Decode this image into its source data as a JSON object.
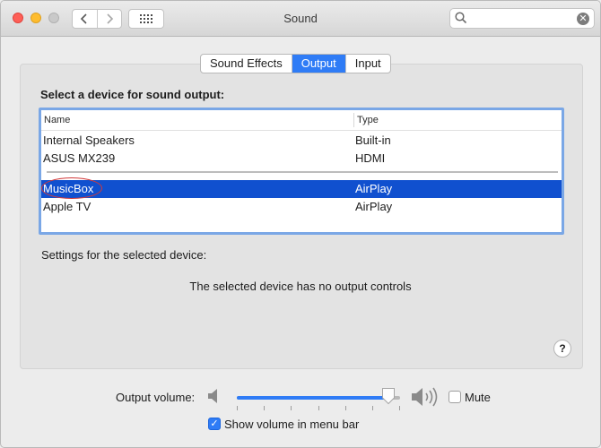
{
  "window": {
    "title": "Sound"
  },
  "search": {
    "placeholder": "",
    "value": ""
  },
  "tabs": [
    {
      "label": "Sound Effects",
      "active": false
    },
    {
      "label": "Output",
      "active": true
    },
    {
      "label": "Input",
      "active": false
    }
  ],
  "output": {
    "heading": "Select a device for sound output:",
    "columns": {
      "name": "Name",
      "type": "Type"
    },
    "devices": [
      {
        "name": "Internal Speakers",
        "type": "Built-in",
        "selected": false
      },
      {
        "name": "ASUS MX239",
        "type": "HDMI",
        "selected": false
      },
      {
        "name": "MusicBox",
        "type": "AirPlay",
        "selected": true
      },
      {
        "name": "Apple TV",
        "type": "AirPlay",
        "selected": false
      }
    ],
    "settings_label": "Settings for the selected device:",
    "no_controls_text": "The selected device has no output controls",
    "help_label": "?"
  },
  "volume": {
    "label": "Output volume:",
    "level": 0.93,
    "mute_label": "Mute",
    "mute_checked": false,
    "show_in_menu_bar_label": "Show volume in menu bar",
    "show_in_menu_bar_checked": true
  },
  "icons": {
    "back": "chevron-left-icon",
    "forward": "chevron-right-icon",
    "show_all": "grid-icon",
    "search": "search-icon",
    "clear": "clear-search-icon",
    "volume_low": "speaker-low-icon",
    "volume_high": "speaker-high-icon"
  },
  "colors": {
    "accent": "#2f7cf6",
    "selection": "#1050cf",
    "annotation": "#d23a3a"
  }
}
